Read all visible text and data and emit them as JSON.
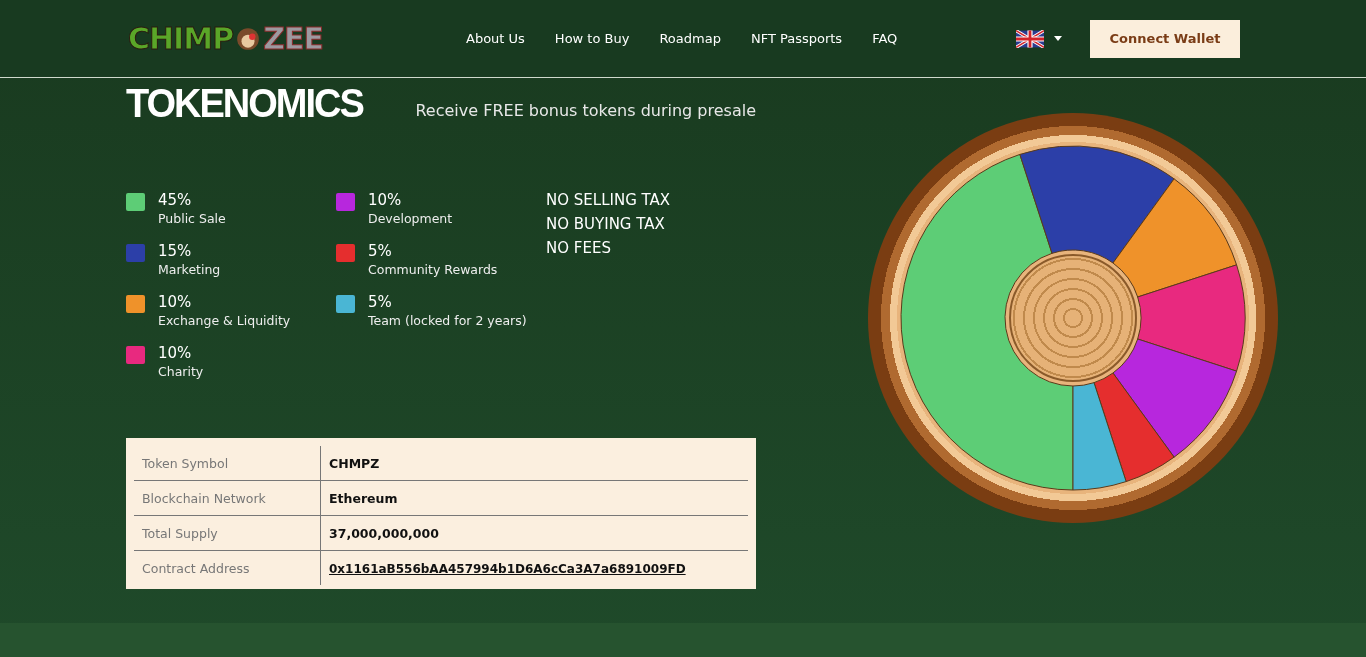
{
  "header": {
    "logo": [
      "CHIMP",
      "ZEE"
    ],
    "nav": [
      "About Us",
      "How to Buy",
      "Roadmap",
      "NFT Passports",
      "FAQ"
    ],
    "connect_button": "Connect Wallet"
  },
  "tokenomics": {
    "title": "TOKENOMICS",
    "subtitle": "Receive FREE bonus tokens during presale",
    "legend": [
      {
        "percent": "45%",
        "color": "#5dcd76"
      },
      {
        "percent": "15%",
        "color": "#2c3fa8"
      },
      {
        "percent": "10%",
        "color": "#ef922a"
      },
      {
        "percent": "10%",
        "color": "#e8297f"
      },
      {
        "percent": "10%",
        "color": "#b727dd"
      },
      {
        "percent": "5%",
        "color": "#e52e2e"
      },
      {
        "percent": "5%",
        "color": "#4ab6d4"
      }
    ],
    "notes": [
      "NO SELLING TAX",
      "NO BUYING TAX",
      "NO FEES"
    ],
    "table": [
      {
        "label": "Token Symbol",
        "value": "CHMPZ",
        "kind": "text"
      },
      {
        "label": "Blockchain Network",
        "value": "Ethereum",
        "kind": "text"
      },
      {
        "label": "Total Supply",
        "value": "37,000,000,000",
        "kind": "text"
      },
      {
        "label": "Contract Address",
        "value": "0x1161aB556bAA457994b1D6A6cCa3A7a6891009FD",
        "kind": "link"
      }
    ],
    "chart_data": {
      "type": "donut",
      "categories": [
        "Public Sale",
        "Marketing",
        "Exchange & Liquidity",
        "Charity",
        "Development",
        "Community Rewards",
        "Team (locked for 2 years)"
      ],
      "values": [
        45,
        15,
        10,
        10,
        10,
        5,
        5
      ]
    }
  }
}
